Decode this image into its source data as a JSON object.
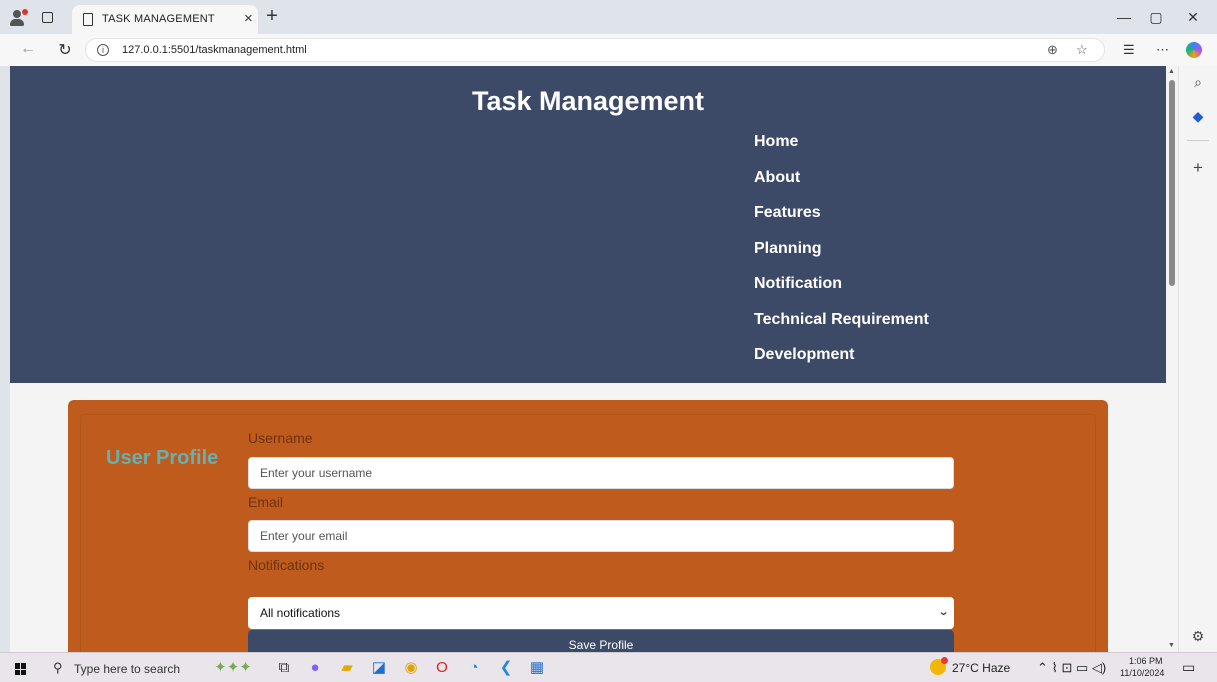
{
  "browser": {
    "tab_title": "TASK MANAGEMENT",
    "url": "127.0.0.1:5501/taskmanagement.html"
  },
  "site": {
    "title": "Task Management",
    "nav": [
      "Home",
      "About",
      "Features",
      "Planning",
      "Notification",
      "Technical Requirement",
      "Development"
    ]
  },
  "profile": {
    "heading": "User Profile",
    "username_label": "Username",
    "username_placeholder": "Enter your username",
    "email_label": "Email",
    "email_placeholder": "Enter your email",
    "notifications_label": "Notifications",
    "notifications_selected": "All notifications",
    "save_label": "Save Profile"
  },
  "taskbar": {
    "search_placeholder": "Type here to search",
    "weather": "27°C  Haze",
    "time": "1:06 PM",
    "date": "11/10/2024"
  },
  "colors": {
    "header_bg": "#3c4a68",
    "card_bg": "#bf5b1c",
    "heading_color": "#67b0b0",
    "label_color": "#6d3211"
  }
}
